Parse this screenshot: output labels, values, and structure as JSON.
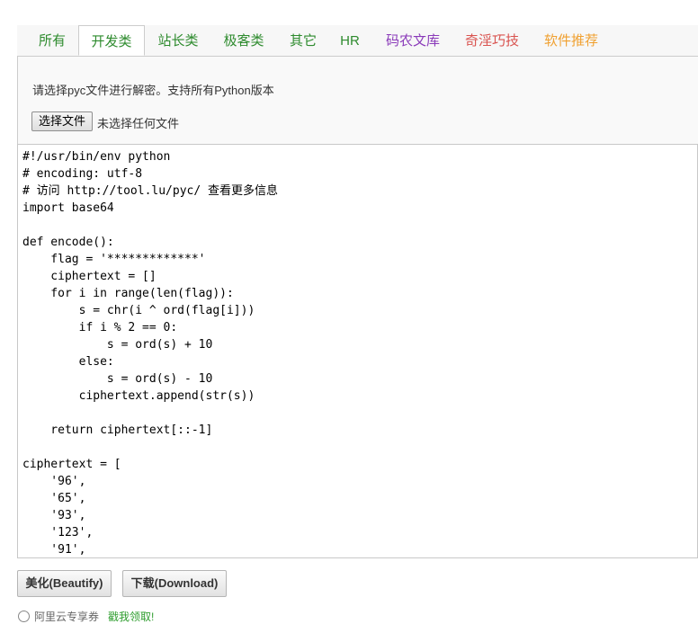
{
  "tabs": [
    {
      "label": "所有",
      "color": "#2e8b2e"
    },
    {
      "label": "开发类",
      "color": "#2e8b2e"
    },
    {
      "label": "站长类",
      "color": "#2e8b2e"
    },
    {
      "label": "极客类",
      "color": "#2e8b2e"
    },
    {
      "label": "其它",
      "color": "#2e8b2e"
    },
    {
      "label": "HR",
      "color": "#2e8b2e"
    },
    {
      "label": "码农文库",
      "color": "#8a3ab9"
    },
    {
      "label": "奇淫巧技",
      "color": "#d9534f"
    },
    {
      "label": "软件推荐",
      "color": "#f0a030"
    }
  ],
  "active_tab": "开发类",
  "upload": {
    "hint": "请选择pyc文件进行解密。支持所有Python版本",
    "choose_button": "选择文件",
    "status": "未选择任何文件"
  },
  "code": "#!/usr/bin/env python\n# encoding: utf-8\n# 访问 http://tool.lu/pyc/ 查看更多信息\nimport base64\n\ndef encode():\n    flag = '*************'\n    ciphertext = []\n    for i in range(len(flag)):\n        s = chr(i ^ ord(flag[i]))\n        if i % 2 == 0:\n            s = ord(s) + 10\n        else:\n            s = ord(s) - 10\n        ciphertext.append(str(s))\n\n    return ciphertext[::-1]\n\nciphertext = [\n    '96',\n    '65',\n    '93',\n    '123',\n    '91',",
  "actions": {
    "beautify": "美化(Beautify)",
    "download": "下载(Download)"
  },
  "footer": {
    "text": "阿里云专享券",
    "link": "戳我领取!"
  }
}
